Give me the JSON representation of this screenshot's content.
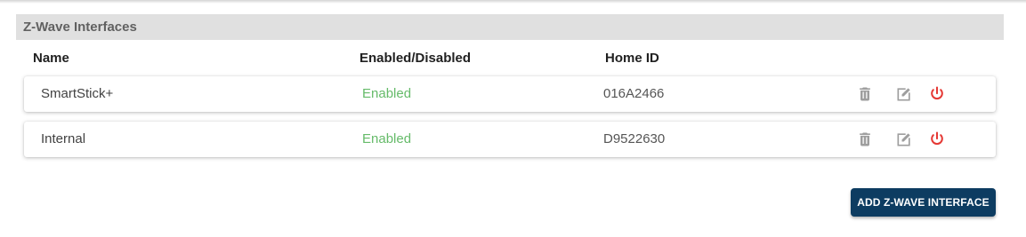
{
  "section": {
    "title": "Z-Wave Interfaces"
  },
  "columns": {
    "name": "Name",
    "enabled": "Enabled/Disabled",
    "home_id": "Home ID"
  },
  "rows": [
    {
      "name": "SmartStick+",
      "status": "Enabled",
      "home_id": "016A2466"
    },
    {
      "name": "Internal",
      "status": "Enabled",
      "home_id": "D9522630"
    }
  ],
  "actions": {
    "delete_icon": "trash-icon",
    "edit_icon": "edit-icon",
    "power_icon": "power-icon"
  },
  "add_button": {
    "label": "ADD Z-WAVE INTERFACE"
  },
  "colors": {
    "header_bg": "#e0e0e0",
    "enabled_text": "#66bb6a",
    "power_icon": "#e53935",
    "action_icon": "#9e9e9e",
    "primary_button": "#0d3c61"
  }
}
